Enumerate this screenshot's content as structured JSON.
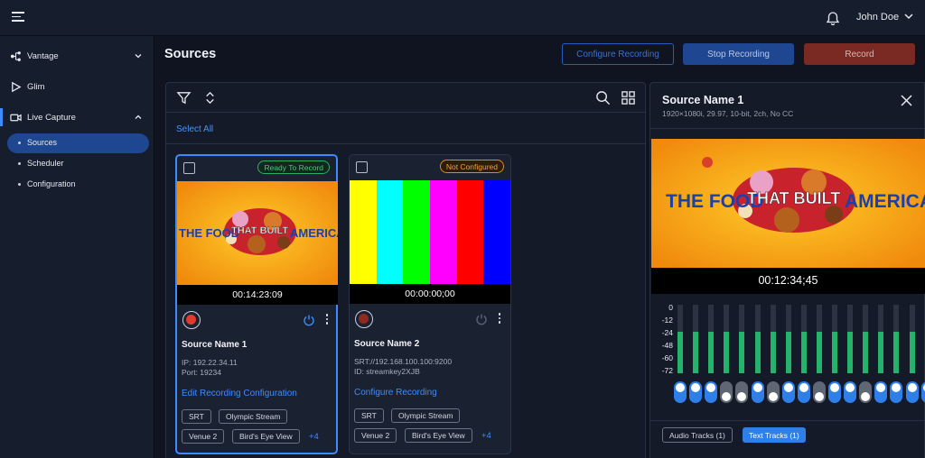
{
  "header": {
    "user_name": "John Doe"
  },
  "sidebar": {
    "items": [
      {
        "label": "Vantage"
      },
      {
        "label": "Glim"
      },
      {
        "label": "Live Capture"
      }
    ],
    "subitems": [
      {
        "label": "Sources"
      },
      {
        "label": "Scheduler"
      },
      {
        "label": "Configuration"
      }
    ]
  },
  "page": {
    "title": "Sources",
    "configure_recording": "Configure Recording",
    "stop_recording": "Stop Recording",
    "record": "Record",
    "select_all": "Select All"
  },
  "cards": [
    {
      "status": "Ready To Record",
      "timecode": "00:14:23:09",
      "name": "Source Name 1",
      "meta1": "IP: 192.22.34.11",
      "meta2": "Port: 19234",
      "link": "Edit Recording Configuration",
      "tags": [
        "SRT",
        "Olympic Stream",
        "Venue 2",
        "Bird's Eye View"
      ],
      "more": "+4",
      "thumb_text": [
        "THE FOOD",
        "THAT BUILT",
        "AMERICA"
      ]
    },
    {
      "status": "Not Configured",
      "timecode": "00:00:00;00",
      "name": "Source Name 2",
      "meta1": "SRT://192.168.100.100:9200",
      "meta2": "ID: streamkey2XJB",
      "link": "Configure Recording",
      "tags": [
        "SRT",
        "Olympic Stream",
        "Venue 2",
        "Bird's Eye View"
      ],
      "more": "+4",
      "color_bars": [
        "#ffff00",
        "#00ffff",
        "#00ff00",
        "#ff00ff",
        "#ff0000",
        "#0000ff"
      ]
    }
  ],
  "detail": {
    "title": "Source Name 1",
    "subtitle": "1920×1080i, 29.97, 10-bit, 2ch, No CC",
    "timecode": "00:12:34;45",
    "thumb_text": [
      "THE FOOD",
      "THAT BUILT",
      "AMERICA"
    ],
    "db_scale": [
      "0",
      "-12",
      "-24",
      "-48",
      "-60",
      "-72"
    ],
    "meter_levels": [
      0.6,
      0.6,
      0.6,
      0.6,
      0.6,
      0.6,
      0.6,
      0.6,
      0.6,
      0.6,
      0.6,
      0.6,
      0.6,
      0.6,
      0.6,
      0.6,
      0.6
    ],
    "channel_toggles": [
      true,
      true,
      true,
      false,
      false,
      true,
      false,
      true,
      true,
      false,
      true,
      true,
      false,
      true,
      true,
      true,
      true
    ],
    "tabs": [
      "Audio Tracks (1)",
      "Text Tracks (1)"
    ],
    "active_tab": 1
  },
  "colors": {
    "accent": "#3d8bff",
    "ready": "#2fae63",
    "not_configured": "#e08a1a",
    "record": "#e23b2e",
    "meter": "#25b26a"
  }
}
